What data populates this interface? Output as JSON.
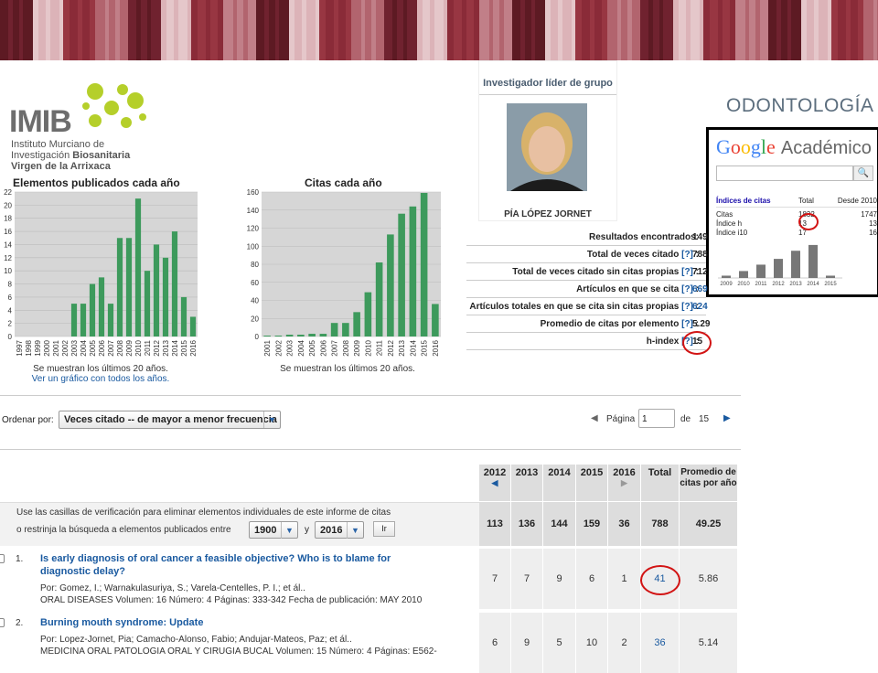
{
  "banner": {
    "colors": [
      "#5a1a22",
      "#c98a92",
      "#8c2c3a",
      "#e7c3c8",
      "#6f2230",
      "#b86b76",
      "#9b3845",
      "#f1d9dc"
    ]
  },
  "logo": {
    "acronym": "IMIB",
    "line1": "Instituto Murciano de",
    "line2_a": "Investigación ",
    "line2_b": "Biosanitaria",
    "line3": "Virgen de la Arrixaca"
  },
  "investigator": {
    "heading": "Investigador líder de grupo",
    "name": "PÍA LÓPEZ JORNET"
  },
  "department": "ODONTOLOGÍA",
  "scholar": {
    "logo_word": "Google",
    "logo_suffix": "Académico",
    "search_placeholder": "",
    "headers": [
      "Índices de citas",
      "Total",
      "Desde 2010"
    ],
    "rows": [
      {
        "label": "Citas",
        "total": "1832",
        "since": "1747"
      },
      {
        "label": "Índice h",
        "total": "13",
        "since": "13"
      },
      {
        "label": "Índice i10",
        "total": "17",
        "since": "16"
      }
    ],
    "chart_years": [
      "2009",
      "2010",
      "2011",
      "2012",
      "2013",
      "2014",
      "2015"
    ]
  },
  "chart_data": [
    {
      "type": "bar",
      "title": "Elementos publicados cada año",
      "categories": [
        "1997",
        "1998",
        "1999",
        "2000",
        "2001",
        "2002",
        "2003",
        "2004",
        "2005",
        "2006",
        "2007",
        "2008",
        "2009",
        "2010",
        "2011",
        "2012",
        "2013",
        "2014",
        "2015",
        "2016"
      ],
      "values": [
        0,
        0,
        0,
        0,
        0,
        0,
        5,
        5,
        8,
        9,
        5,
        15,
        15,
        21,
        10,
        14,
        12,
        16,
        6,
        3
      ],
      "ylim": [
        0,
        22
      ],
      "yticks": [
        0,
        2,
        4,
        6,
        8,
        10,
        12,
        14,
        16,
        18,
        20,
        22
      ],
      "color": "#3d9a5c",
      "note": "Se muestran los últimos 20 años.",
      "link": "Ver un gráfico con todos los años."
    },
    {
      "type": "bar",
      "title": "Citas cada año",
      "categories": [
        "2001",
        "2002",
        "2003",
        "2004",
        "2005",
        "2006",
        "2007",
        "2008",
        "2009",
        "2010",
        "2011",
        "2012",
        "2013",
        "2014",
        "2015",
        "2016"
      ],
      "values": [
        1,
        1,
        2,
        2,
        3,
        3,
        15,
        15,
        27,
        49,
        82,
        113,
        136,
        144,
        159,
        36
      ],
      "ylim": [
        0,
        160
      ],
      "yticks": [
        0,
        20,
        40,
        60,
        80,
        100,
        120,
        140,
        160
      ],
      "color": "#3d9a5c",
      "note": "Se muestran los últimos 20 años."
    },
    {
      "type": "bar",
      "title": "",
      "categories": [
        "2009",
        "2010",
        "2011",
        "2012",
        "2013",
        "2014",
        "2015"
      ],
      "values": [
        40,
        120,
        230,
        330,
        470,
        570,
        40
      ],
      "color": "#777777"
    }
  ],
  "stats": [
    {
      "label": "Resultados encontrados:",
      "q": "",
      "value": "149",
      "link": false
    },
    {
      "label": "Total de veces citado ",
      "q": "[?]",
      "value": "788",
      "link": false
    },
    {
      "label": "Total de veces citado sin citas propias ",
      "q": "[?]",
      "value": "712",
      "link": false
    },
    {
      "label": "Artículos en que se cita ",
      "q": "[?]",
      "value": "669",
      "link": true
    },
    {
      "label": "Artículos totales en que se cita sin citas propias ",
      "q": "[?]",
      "value": "624",
      "link": true
    },
    {
      "label": "Promedio de citas por elemento ",
      "q": "[?]",
      "value": "5.29",
      "link": false
    },
    {
      "label": "h-index ",
      "q": "[?]",
      "value": "15",
      "link": false
    }
  ],
  "sort": {
    "label": "Ordenar por:",
    "value": "Veces citado -- de mayor a menor frecuencia"
  },
  "pager": {
    "label": "Página",
    "value": "1",
    "of": "de",
    "total": "15"
  },
  "table": {
    "headers": [
      "2012",
      "2013",
      "2014",
      "2015",
      "2016",
      "Total",
      "Promedio de citas por año"
    ],
    "instructions1": "Use las casillas de verificación para eliminar elementos individuales de este informe de citas",
    "instructions2": "o restrinja la búsqueda a elementos publicados entre",
    "from_year": "1900",
    "and": "y",
    "to_year": "2016",
    "go": "Ir",
    "totals": [
      "113",
      "136",
      "144",
      "159",
      "36",
      "788",
      "49.25"
    ],
    "rows": [
      {
        "num": "1.",
        "title1": "Is early diagnosis of oral cancer a feasible objective? Who is to blame for",
        "title2": "diagnostic delay?",
        "authors": "Por: Gomez, I.; Warnakulasuriya, S.; Varela-Centelles, P. I.; et ál..",
        "source": "ORAL DISEASES  Volumen: 16   Número: 4   Páginas: 333-342   Fecha de publicación: MAY 2010",
        "values": [
          "7",
          "7",
          "9",
          "6",
          "1",
          "41",
          "5.86"
        ]
      },
      {
        "num": "2.",
        "title1": "Burning mouth syndrome: Update",
        "title2": "",
        "authors": "Por: Lopez-Jornet, Pia; Camacho-Alonso, Fabio; Andujar-Mateos, Paz; et ál..",
        "source": "MEDICINA ORAL PATOLOGIA ORAL Y CIRUGIA BUCAL  Volumen: 15   Número: 4   Páginas: E562-",
        "values": [
          "6",
          "9",
          "5",
          "10",
          "2",
          "36",
          "5.14"
        ]
      }
    ]
  }
}
